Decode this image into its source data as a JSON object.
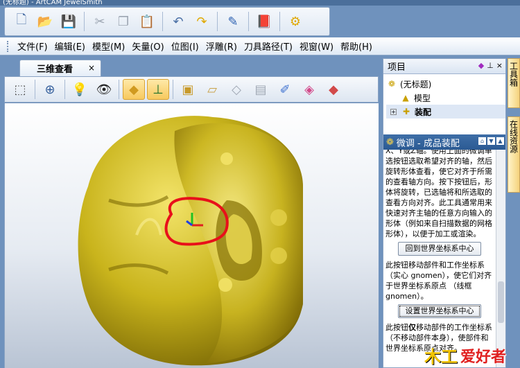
{
  "window": {
    "title": "(无标题) - ArtCAM JewelSmith"
  },
  "toolbar": {
    "buttons": [
      {
        "name": "new-file-icon",
        "glyph": "🗋",
        "enabled": true
      },
      {
        "name": "open-folder-icon",
        "glyph": "📂",
        "enabled": true
      },
      {
        "name": "save-icon",
        "glyph": "💾",
        "enabled": true
      },
      {
        "name": "cut-icon",
        "glyph": "✂",
        "enabled": false
      },
      {
        "name": "copy-icon",
        "glyph": "❐",
        "enabled": false
      },
      {
        "name": "paste-icon",
        "glyph": "📋",
        "enabled": false
      },
      {
        "name": "undo-icon",
        "glyph": "↶",
        "enabled": true
      },
      {
        "name": "redo-icon",
        "glyph": "↷",
        "enabled": true
      },
      {
        "name": "notes-icon",
        "glyph": "✎",
        "enabled": true
      },
      {
        "name": "help-book-icon",
        "glyph": "📕",
        "enabled": true
      },
      {
        "name": "whats-this-icon",
        "glyph": "⚙",
        "enabled": true
      }
    ]
  },
  "menu": {
    "items": [
      "文件(F)",
      "编辑(E)",
      "模型(M)",
      "矢量(O)",
      "位图(I)",
      "浮雕(R)",
      "刀具路径(T)",
      "视窗(W)",
      "帮助(H)"
    ]
  },
  "document": {
    "tab_label": "三维查看",
    "close_glyph": "×"
  },
  "view_toolbar": {
    "buttons": [
      {
        "name": "wireframe-cube-icon",
        "glyph": "⬚",
        "active": false
      },
      {
        "name": "zoom-icon",
        "glyph": "⊕",
        "active": false
      },
      {
        "name": "light-bulb-icon",
        "glyph": "💡",
        "active": false
      },
      {
        "name": "eye-icon",
        "glyph": "👁",
        "active": false
      },
      {
        "name": "shaded-plane-icon",
        "glyph": "◆",
        "active": true
      },
      {
        "name": "axes-icon",
        "glyph": "⊥",
        "active": true
      },
      {
        "name": "box-icon",
        "glyph": "▣",
        "active": false
      },
      {
        "name": "slab-icon",
        "glyph": "▱",
        "active": false
      },
      {
        "name": "layer-icon",
        "glyph": "◇",
        "active": false
      },
      {
        "name": "stack-icon",
        "glyph": "▤",
        "active": false
      },
      {
        "name": "brush-icon",
        "glyph": "✐",
        "active": false
      },
      {
        "name": "color-plane-icon",
        "glyph": "◈",
        "active": false
      },
      {
        "name": "red-layer-icon",
        "glyph": "◆",
        "active": false
      }
    ]
  },
  "project_panel": {
    "title": "项目",
    "tree": [
      {
        "label": "(无标题)",
        "indent": 0,
        "icon": "project-icon"
      },
      {
        "label": "模型",
        "indent": 1,
        "icon": "model-icon"
      },
      {
        "label": "装配",
        "indent": 1,
        "icon": "assembly-icon",
        "expander": "+"
      }
    ]
  },
  "tweak_panel": {
    "title": "微调 - 成品装配",
    "para1": "X、Y或Z轴。使用上面的微调单选按钮选取希望对齐的轴，然后旋转形体查看，使它对齐于所需的查看轴方向。按下按钮后，形体将旋转，已选轴将和所选取的查看方向对齐。此工具通常用来快速对齐主轴的任意方向输入的形体（例如来自扫描数据的网格形体），以便于加工或渲染。",
    "button1": "回到世界坐标系中心",
    "para2": "此按钮移动部件和工作坐标系（实心 gnomen），使它们对齐于世界坐标系原点 （线框gnomen）。",
    "button2": "设置世界坐标系中心",
    "para3_prefix": "此按钮",
    "para3_bold": "仅",
    "para3_rest": "移动部件的工作坐标系（不移动部件本身），使部件和世界坐标系原点对齐。"
  },
  "side_tabs": [
    "工具箱",
    "在线资源"
  ],
  "watermark": {
    "part1": "木工",
    "part2": "爱好者"
  },
  "colors": {
    "model_gold": "#c9b41c",
    "model_highlight": "#f3e46a",
    "annotation_red": "#e8101a",
    "panel_header": "#2b5a93"
  }
}
